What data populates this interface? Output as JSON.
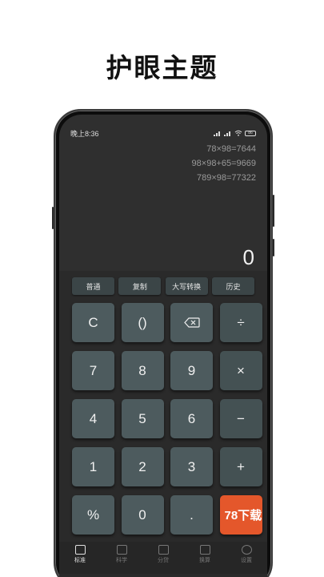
{
  "headline": "护眼主题",
  "status": {
    "time": "晚上8:36",
    "battery": "86"
  },
  "history": [
    "78×98=7644",
    "98×98+65=9669",
    "789×98=77322"
  ],
  "display": "0",
  "functions": [
    "普通",
    "复制",
    "大写转换",
    "历史"
  ],
  "keys": {
    "clear": "C",
    "parens": "()",
    "backspace": "backspace-icon",
    "divide": "÷",
    "seven": "7",
    "eight": "8",
    "nine": "9",
    "multiply": "×",
    "four": "4",
    "five": "5",
    "six": "6",
    "minus": "−",
    "one": "1",
    "two": "2",
    "three": "3",
    "plus": "+",
    "percent": "%",
    "zero": "0",
    "dot": ".",
    "equals_overlay": "78下载"
  },
  "tabs": [
    "标准",
    "科学",
    "分贷",
    "换算",
    "设置"
  ],
  "colors": {
    "key": "#4d5b5e",
    "accent": "#e4572b",
    "screen": "#2f2f2f"
  }
}
